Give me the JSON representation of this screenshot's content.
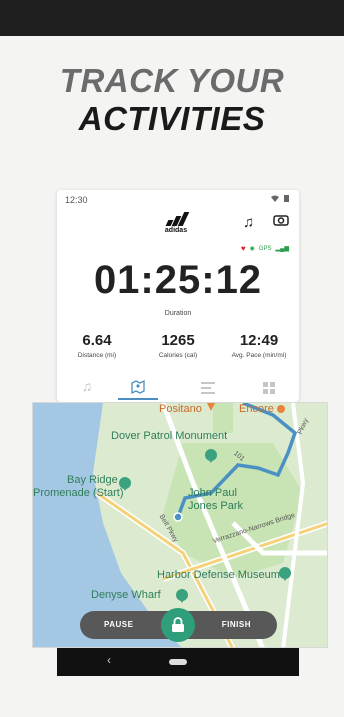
{
  "headline": {
    "line1": "TRACK YOUR",
    "line2": "ACTIVITIES"
  },
  "status_bar": {
    "time": "12:30"
  },
  "brand": {
    "logo_text": "adidas"
  },
  "gps": {
    "label": "GPS"
  },
  "tracker": {
    "duration": "01:25:12",
    "duration_label": "Duration",
    "stats": [
      {
        "value": "6.64",
        "label": "Distance (mi)"
      },
      {
        "value": "1265",
        "label": "Calories (cal)"
      },
      {
        "value": "12:49",
        "label": "Avg. Pace (min/mi)"
      }
    ]
  },
  "tabs": [
    {
      "icon": "music-icon"
    },
    {
      "icon": "map-icon",
      "active": true
    },
    {
      "icon": "list-icon"
    },
    {
      "icon": "grid-icon"
    }
  ],
  "map": {
    "labels": {
      "positano": "Positano",
      "encore": "Encore",
      "monument": "Dover Patrol Monument",
      "bay_ridge_1": "Bay Ridge",
      "bay_ridge_2": "Promenade (Start)",
      "park_1": "John Paul",
      "park_2": "Jones Park",
      "belt_pkwy": "Belt Pkwy",
      "bridge": "Verrazzano-Narrows Bridge",
      "route_101": "101",
      "pkwy": "Pkwy",
      "museum": "Harbor Defense Museum",
      "wharf": "Denyse Wharf"
    },
    "colors": {
      "water": "#a4c8e3",
      "land": "#dcebd0",
      "route": "#4a90c2",
      "road": "#f5d27a"
    }
  },
  "controls": {
    "pause_label": "PAUSE",
    "finish_label": "FINISH",
    "lock_color": "#2f9e7a"
  }
}
